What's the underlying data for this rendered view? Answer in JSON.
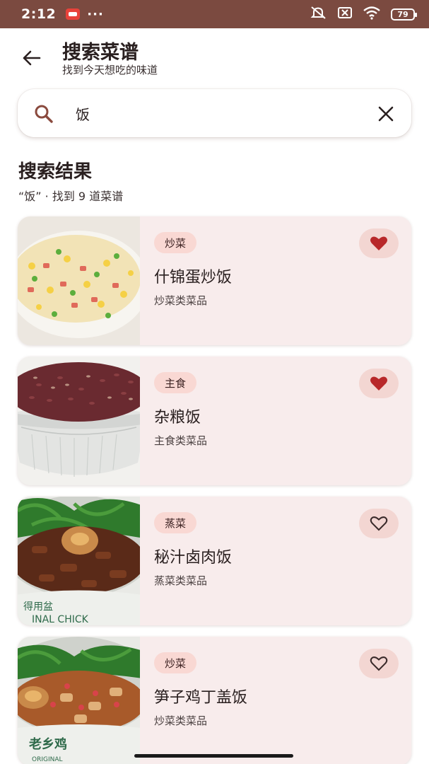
{
  "status": {
    "time": "2:12",
    "dots": "···",
    "battery": "79"
  },
  "header": {
    "title": "搜索菜谱",
    "subtitle": "找到今天想吃的味道"
  },
  "search": {
    "value": "饭",
    "placeholder": ""
  },
  "results": {
    "title": "搜索结果",
    "summary": "“饭” · 找到 9 道菜谱"
  },
  "recipes": [
    {
      "tag": "炒菜",
      "name": "什锦蛋炒饭",
      "category": "炒菜类菜品",
      "favorited": true,
      "image": "fried-rice"
    },
    {
      "tag": "主食",
      "name": "杂粮饭",
      "category": "主食类菜品",
      "favorited": true,
      "image": "multigrain-rice"
    },
    {
      "tag": "蒸菜",
      "name": "秘汁卤肉饭",
      "category": "蒸菜类菜品",
      "favorited": false,
      "image": "braised-pork-rice"
    },
    {
      "tag": "炒菜",
      "name": "笋子鸡丁盖饭",
      "category": "炒菜类菜品",
      "favorited": false,
      "image": "chicken-rice-bowl"
    }
  ],
  "colors": {
    "status_bar": "#7b4a40",
    "card_bg": "#f8ecec",
    "tag_bg": "#f9d8d3",
    "fav_active": "#b8282a"
  }
}
